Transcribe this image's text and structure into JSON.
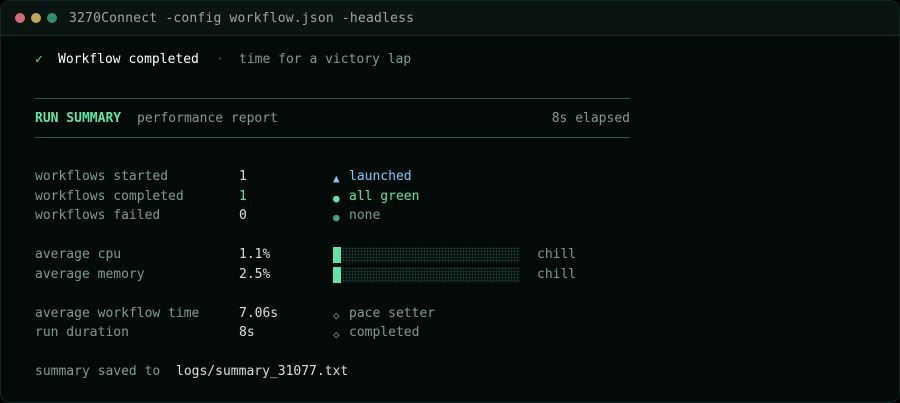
{
  "window": {
    "title": "3270Connect -config workflow.json -headless",
    "controls": [
      "close",
      "minimize",
      "maximize"
    ],
    "colors": {
      "close": "#d36a7a",
      "minimize": "#c6a35a",
      "maximize": "#2e8f72"
    }
  },
  "status": {
    "check": "✓",
    "message": "Workflow completed",
    "separator": "·",
    "tagline": "time for a victory lap"
  },
  "summary": {
    "heading": "RUN SUMMARY",
    "subheading": "performance report",
    "elapsed": "8s elapsed"
  },
  "counts": [
    {
      "label": "workflows started",
      "value": "1",
      "marker": "▲",
      "status": "launched"
    },
    {
      "label": "workflows completed",
      "value": "1",
      "marker": "●",
      "status": "all green"
    },
    {
      "label": "workflows failed",
      "value": "0",
      "marker": "●",
      "status": "none"
    }
  ],
  "resources": [
    {
      "label": "average cpu",
      "value": "1.1%",
      "fraction": 0.011,
      "note": "chill"
    },
    {
      "label": "average memory",
      "value": "2.5%",
      "fraction": 0.025,
      "note": "chill"
    }
  ],
  "timing": [
    {
      "label": "average workflow time",
      "value": "7.06s",
      "marker": "◇",
      "status": "pace setter"
    },
    {
      "label": "run duration",
      "value": "8s",
      "marker": "◇",
      "status": "completed"
    }
  ],
  "footer": {
    "prefix": "summary saved to",
    "path": "logs/summary_31077.txt"
  },
  "colors": {
    "accent": "#5fe6a4",
    "info": "#7cc9ff",
    "muted": "#7f9a93",
    "rule": "#1e5a50"
  }
}
